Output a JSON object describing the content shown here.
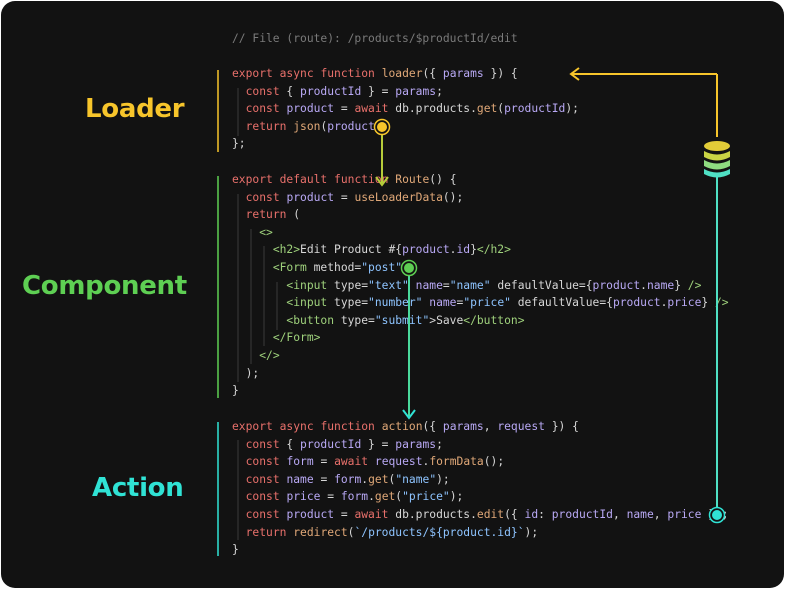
{
  "labels": {
    "loader": "Loader",
    "component": "Component",
    "action": "Action"
  },
  "colors": {
    "loader": "#f7c52b",
    "component": "#5ecf53",
    "action": "#30e3d5",
    "background": "#121212"
  },
  "icons": {
    "database": "database-icon"
  },
  "code": {
    "comment": "// File (route): /products/$productId/edit",
    "loader": {
      "line1": "export async function loader({ params }) {",
      "line2": "  const { productId } = params;",
      "line3": "  const product = await db.products.get(productId);",
      "line4": "  return json(product);",
      "line5": "};"
    },
    "component": {
      "line1": "export default function Route() {",
      "line2": "  const product = useLoaderData();",
      "line3": "  return (",
      "line4": "    <>",
      "line5": "      <h2>Edit Product #{product.id}</h2>",
      "line6": "      <Form method=\"post\">",
      "line7": "        <input type=\"text\" name=\"name\" defaultValue={product.name} />",
      "line8": "        <input type=\"number\" name=\"price\" defaultValue={product.price} />",
      "line9": "        <button type=\"submit\">Save</button>",
      "line10": "      </Form>",
      "line11": "    </>",
      "line12": "  );",
      "line13": "}"
    },
    "action": {
      "line1": "export async function action({ params, request }) {",
      "line2": "  const { productId } = params;",
      "line3": "  const form = await request.formData();",
      "line4": "  const name = form.get(\"name\");",
      "line5": "  const price = form.get(\"price\");",
      "line6": "  const product = await db.products.edit({ id: productId, name, price });",
      "line7": "  return redirect(`/products/${product.id}`);",
      "line8": "}"
    }
  }
}
